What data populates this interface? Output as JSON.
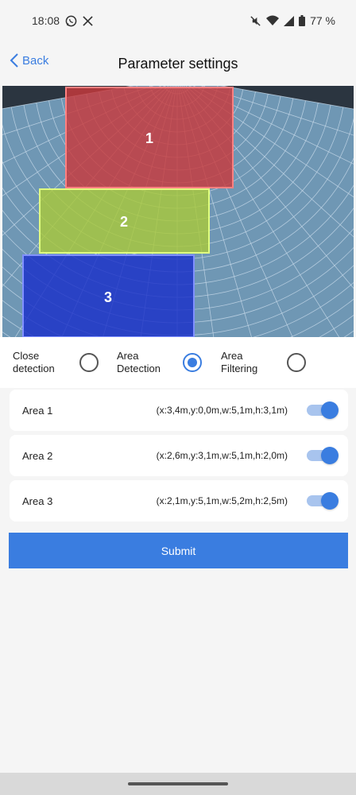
{
  "status": {
    "time": "18:08",
    "battery": "77 %",
    "icons_left": [
      "whatsapp-icon",
      "x-icon"
    ],
    "icons_right": [
      "mute-icon",
      "wifi-icon",
      "signal-icon",
      "battery-icon"
    ]
  },
  "nav": {
    "back_label": "Back",
    "title": "Parameter settings"
  },
  "radar": {
    "zones": [
      {
        "label": "1",
        "fill": "#c8393c",
        "stroke": "#ff8080"
      },
      {
        "label": "2",
        "fill": "#a8c83a",
        "stroke": "#e0ff80"
      },
      {
        "label": "3",
        "fill": "#1a2fc8",
        "stroke": "#8090ff"
      }
    ]
  },
  "modes": [
    {
      "label": "Close detection",
      "selected": false
    },
    {
      "label": "Area Detection",
      "selected": true
    },
    {
      "label": "Area Filtering",
      "selected": false
    }
  ],
  "areas": [
    {
      "name": "Area 1",
      "values": "(x:3,4m,y:0,0m,w:5,1m,h:3,1m)",
      "enabled": true
    },
    {
      "name": "Area 2",
      "values": "(x:2,6m,y:3,1m,w:5,1m,h:2,0m)",
      "enabled": true
    },
    {
      "name": "Area 3",
      "values": "(x:2,1m,y:5,1m,w:5,2m,h:2,5m)",
      "enabled": true
    }
  ],
  "submit_label": "Submit",
  "colors": {
    "accent": "#3a7de0"
  }
}
